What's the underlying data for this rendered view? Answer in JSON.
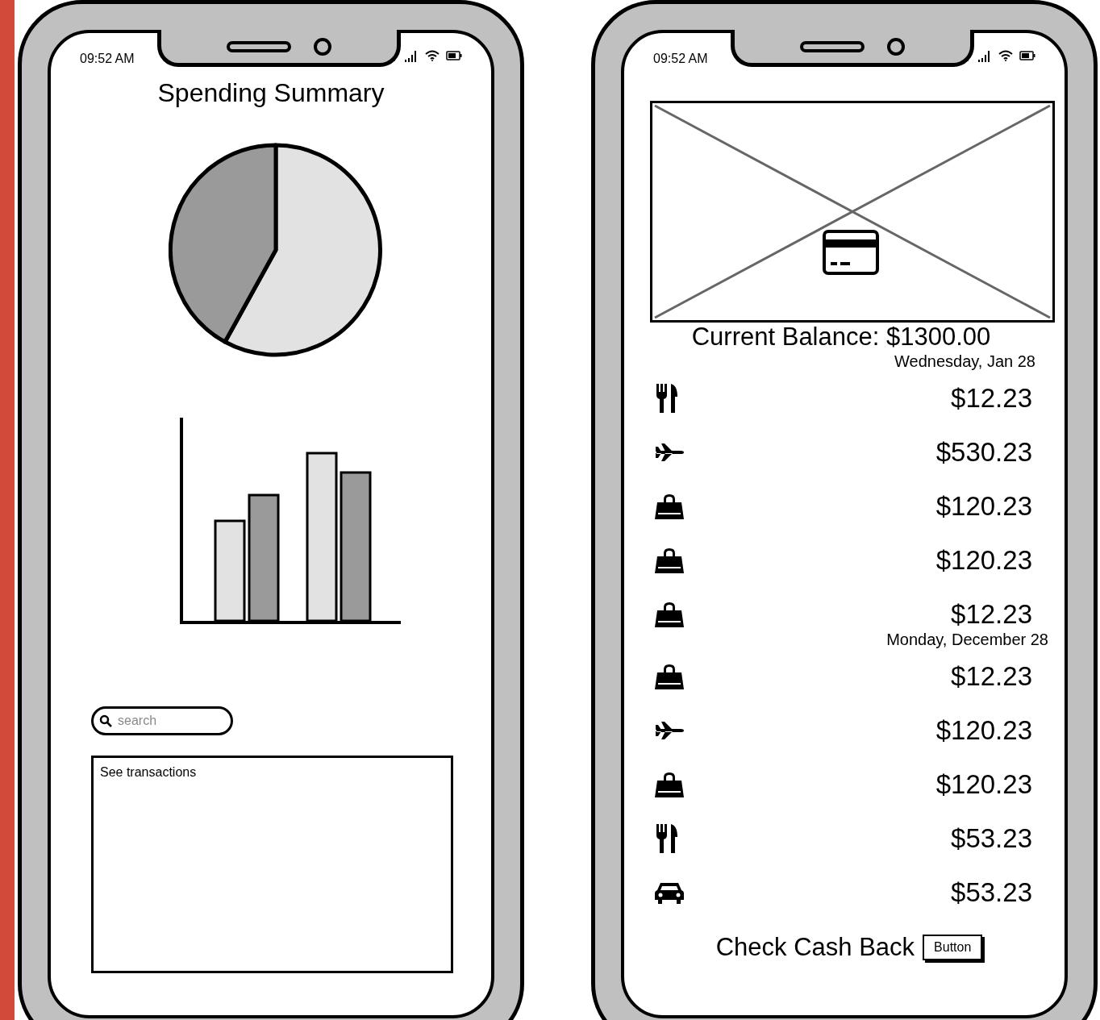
{
  "phones": [
    {
      "status_time": "09:52 AM",
      "title": "Spending Summary",
      "search": {
        "placeholder": "search"
      },
      "transactions_box": {
        "label": "See transactions"
      }
    },
    {
      "status_time": "09:52 AM",
      "balance": "Current Balance: $1300.00",
      "groups": [
        {
          "date": "Wednesday, Jan 28",
          "items": [
            {
              "kind": "food",
              "amount": "$12.23"
            },
            {
              "kind": "plane",
              "amount": "$530.23"
            },
            {
              "kind": "bag",
              "amount": "$120.23"
            },
            {
              "kind": "bag",
              "amount": "$120.23"
            },
            {
              "kind": "bag",
              "amount": "$12.23"
            }
          ]
        },
        {
          "date": "Monday, December 28",
          "items": [
            {
              "kind": "bag",
              "amount": "$12.23"
            },
            {
              "kind": "plane",
              "amount": "$120.23"
            },
            {
              "kind": "bag",
              "amount": "$120.23"
            },
            {
              "kind": "food",
              "amount": "$53.23"
            },
            {
              "kind": "car",
              "amount": "$53.23"
            }
          ]
        }
      ],
      "cash_back": {
        "label": "Check Cash Back",
        "button": "Button"
      }
    }
  ]
}
